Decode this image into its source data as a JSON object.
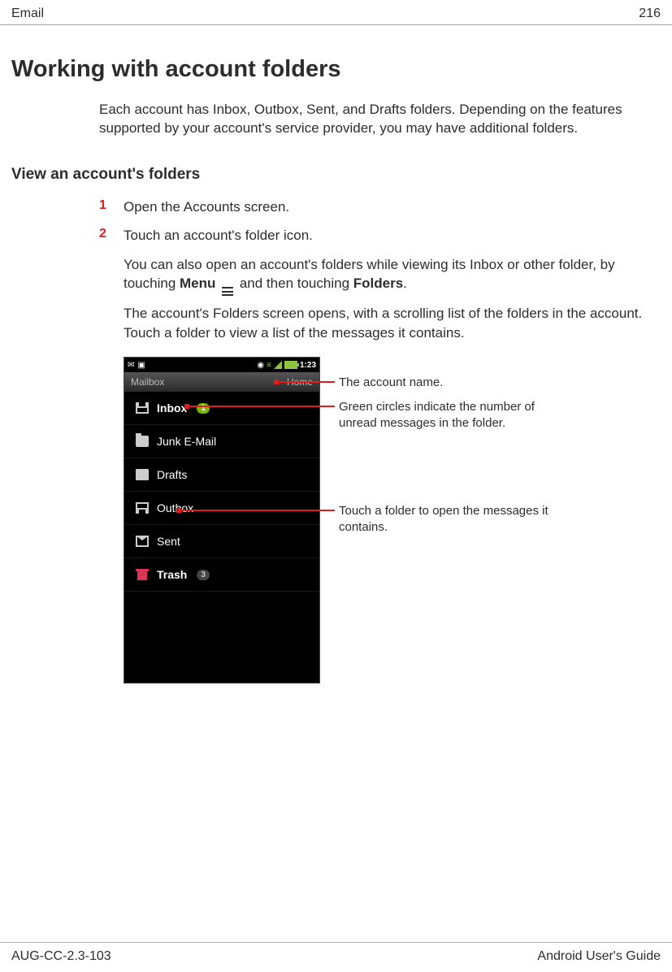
{
  "header": {
    "left": "Email",
    "right": "216"
  },
  "h1": "Working with account folders",
  "intro": "Each account has Inbox, Outbox, Sent, and Drafts folders. Depending on the features supported by your account's service provider, you may have additional folders.",
  "h2": "View an account's folders",
  "steps": {
    "s1": {
      "num": "1",
      "text": "Open the Accounts screen."
    },
    "s2": {
      "num": "2",
      "text": "Touch an account's folder icon."
    }
  },
  "body1_a": "You can also open an account's folders while viewing its Inbox or other folder, by touching ",
  "body1_menu": "Menu",
  "body1_b": " and then touching ",
  "body1_folders": "Folders",
  "body1_c": ".",
  "body2": "The account's Folders screen opens, with a scrolling list of the folders in the account. Touch a folder to view a list of the messages it contains.",
  "phone": {
    "time": "1:23",
    "title_left": "Mailbox",
    "title_right": "Home",
    "folders": {
      "inbox": {
        "label": "Inbox",
        "badge": "1"
      },
      "junk": {
        "label": "Junk E-Mail"
      },
      "drafts": {
        "label": "Drafts"
      },
      "outbox": {
        "label": "Outbox"
      },
      "sent": {
        "label": "Sent"
      },
      "trash": {
        "label": "Trash",
        "badge": "3"
      }
    }
  },
  "callouts": {
    "c1": "The account name.",
    "c2": "Green circles indicate the number of unread messages in the folder.",
    "c3": "Touch a folder to open the messages it contains."
  },
  "footer": {
    "left": "AUG-CC-2.3-103",
    "right": "Android User's Guide"
  }
}
